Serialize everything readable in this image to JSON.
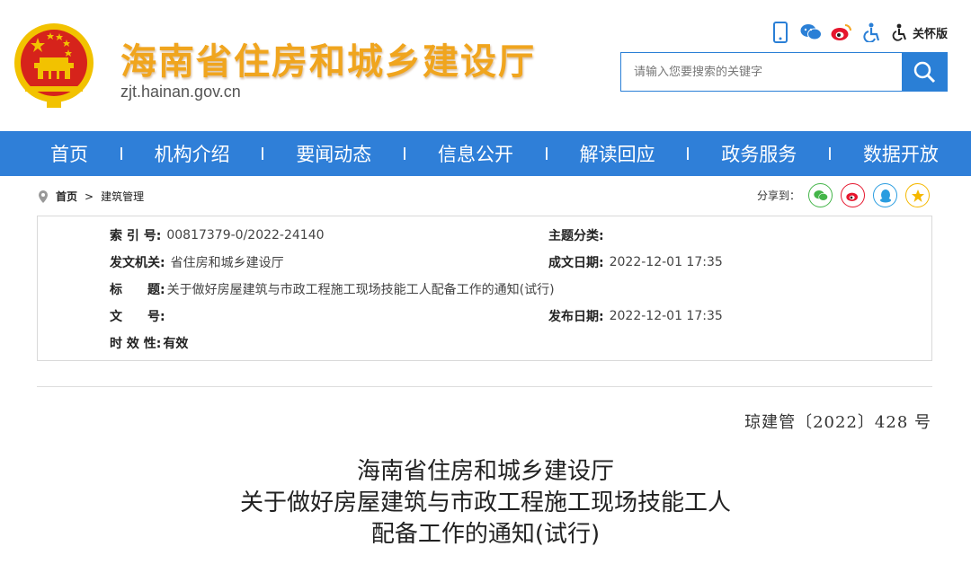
{
  "header": {
    "site_title": "海南省住房和城乡建设厅",
    "domain": "zjt.hainan.gov.cn",
    "elder_mode": "关怀版",
    "search_placeholder": "请输入您要搜索的关键字",
    "icons": [
      "mobile-icon",
      "wechat-icon",
      "weibo-icon",
      "accessibility-icon",
      "elder-care-icon",
      "search-icon"
    ]
  },
  "nav": {
    "items": [
      {
        "label": "首页"
      },
      {
        "label": "机构介绍"
      },
      {
        "label": "要闻动态"
      },
      {
        "label": "信息公开"
      },
      {
        "label": "解读回应"
      },
      {
        "label": "政务服务"
      },
      {
        "label": "数据开放"
      }
    ]
  },
  "breadcrumb": {
    "home": "首页",
    "sep": ">",
    "current": "建筑管理"
  },
  "share": {
    "label": "分享到：",
    "targets": [
      "wechat",
      "weibo",
      "qq",
      "qzone"
    ]
  },
  "info": {
    "index_label": "索 引 号:",
    "index_value": "00817379-0/2022-24140",
    "topic_label": "主题分类:",
    "topic_value": "",
    "issuer_label": "发文机关:",
    "issuer_value": "省住房和城乡建设厅",
    "written_label": "成文日期:",
    "written_value": "2022-12-01 17:35",
    "title_label": "标　　题:",
    "title_value": "关于做好房屋建筑与市政工程施工现场技能工人配备工作的通知(试行)",
    "docno_label": "文　　号:",
    "docno_value": "",
    "published_label": "发布日期:",
    "published_value": "2022-12-01 17:35",
    "validity_label": "时 效 性:",
    "validity_value": "有效"
  },
  "article": {
    "doc_number": "琼建管〔2022〕428 号",
    "title_line1": "海南省住房和城乡建设厅",
    "title_line2": "关于做好房屋建筑与市政工程施工现场技能工人",
    "title_line3": "配备工作的通知(试行)"
  },
  "colors": {
    "primary": "#2f7fd8",
    "title_gold": "#f0a51e",
    "wechat": "#44b549",
    "weibo": "#e6162d",
    "qq": "#2a9de0",
    "qzone": "#f5b800"
  }
}
